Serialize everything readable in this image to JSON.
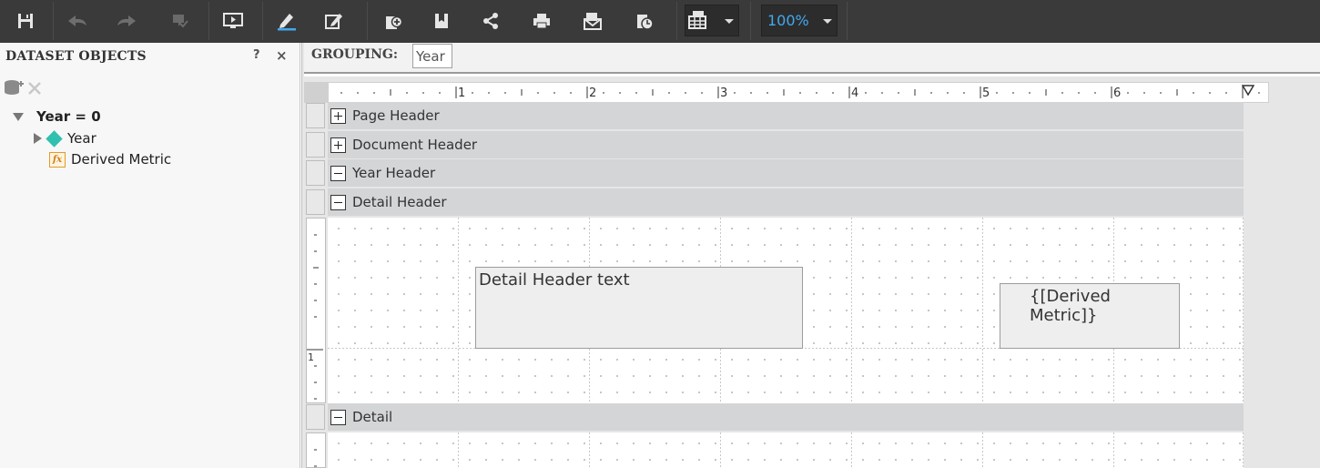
{
  "toolbar": {
    "buttons": [
      "save-icon",
      "undo-icon",
      "redo-icon",
      "stamp-icon",
      "present-icon",
      "pen-icon",
      "edit-icon",
      "add-page-icon",
      "bookmark-icon",
      "share-icon",
      "print-icon",
      "email-icon",
      "schedule-icon",
      "layout-icon"
    ],
    "zoom": {
      "value": "100%"
    },
    "accent": "#41a9f0"
  },
  "panel": {
    "title": "DATASET OBJECTS",
    "help": "?",
    "close": "×",
    "tree": [
      {
        "label": "Year = 0",
        "type": "group"
      },
      {
        "label": "Year",
        "type": "attribute"
      },
      {
        "label": "Derived Metric",
        "type": "metric",
        "icon_text": "fx"
      }
    ]
  },
  "grouping": {
    "label": "GROUPING:",
    "chip": "Year"
  },
  "ruler": {
    "numbers": [
      "1",
      "2",
      "3",
      "4",
      "5",
      "6"
    ]
  },
  "vruler": {
    "numbers": [
      "1"
    ]
  },
  "bands": [
    {
      "label": "Page Header",
      "expanded": false
    },
    {
      "label": "Document Header",
      "expanded": false
    },
    {
      "label": "Year Header",
      "expanded": true
    },
    {
      "label": "Detail Header",
      "expanded": true
    },
    {
      "label": "Detail",
      "expanded": true
    }
  ],
  "detail_header": {
    "text_box": "Detail Header text",
    "metric_box": "{[Derived Metric]}"
  }
}
